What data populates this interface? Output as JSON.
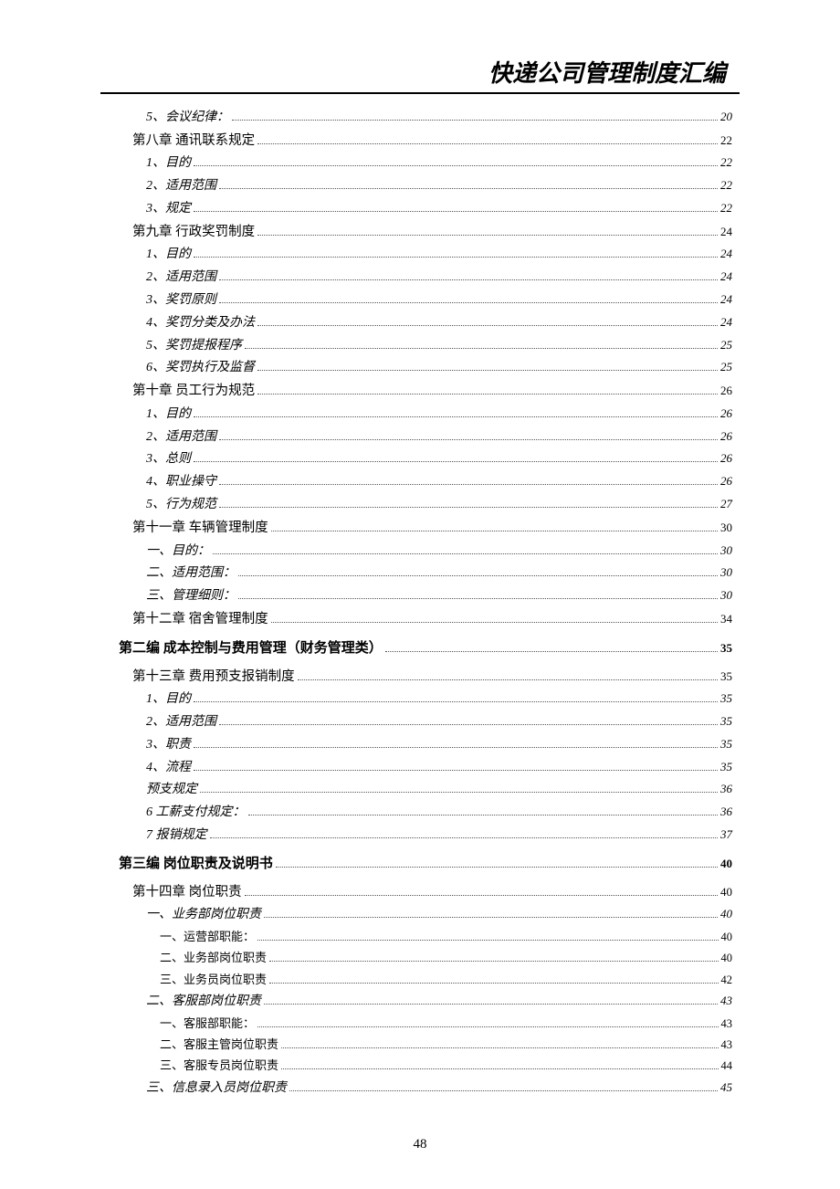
{
  "header": {
    "title": "快递公司管理制度汇编"
  },
  "toc": [
    {
      "indent": 2,
      "label": "5、会议纪律：",
      "page": "20"
    },
    {
      "indent": 1,
      "label": "第八章 通讯联系规定",
      "page": "22"
    },
    {
      "indent": 2,
      "label": "1、目的",
      "page": "22"
    },
    {
      "indent": 2,
      "label": "2、适用范围",
      "page": "22"
    },
    {
      "indent": 2,
      "label": "3、规定",
      "page": "22"
    },
    {
      "indent": 1,
      "label": "第九章 行政奖罚制度",
      "page": "24"
    },
    {
      "indent": 2,
      "label": "1、目的",
      "page": "24"
    },
    {
      "indent": 2,
      "label": "2、适用范围",
      "page": "24"
    },
    {
      "indent": 2,
      "label": "3、奖罚原则",
      "page": "24"
    },
    {
      "indent": 2,
      "label": "4、奖罚分类及办法",
      "page": "24"
    },
    {
      "indent": 2,
      "label": "5、奖罚提报程序",
      "page": "25"
    },
    {
      "indent": 2,
      "label": "6、奖罚执行及监督",
      "page": "25"
    },
    {
      "indent": 1,
      "label": "第十章 员工行为规范",
      "page": "26"
    },
    {
      "indent": 2,
      "label": "1、目的",
      "page": "26"
    },
    {
      "indent": 2,
      "label": "2、适用范围",
      "page": "26"
    },
    {
      "indent": 2,
      "label": "3、总则",
      "page": "26"
    },
    {
      "indent": 2,
      "label": "4、职业操守",
      "page": "26"
    },
    {
      "indent": 2,
      "label": "5、行为规范",
      "page": "27"
    },
    {
      "indent": 1,
      "label": "第十一章 车辆管理制度",
      "page": "30"
    },
    {
      "indent": 2,
      "label": "一、目的：",
      "page": "30"
    },
    {
      "indent": 2,
      "label": "二、适用范围：",
      "page": "30"
    },
    {
      "indent": 2,
      "label": "三、管理细则：",
      "page": "30"
    },
    {
      "indent": 1,
      "label": "第十二章 宿舍管理制度",
      "page": "34"
    },
    {
      "indent": 0,
      "label": "第二编  成本控制与费用管理（财务管理类）",
      "page": "35"
    },
    {
      "indent": 1,
      "label": "第十三章 费用预支报销制度",
      "page": "35"
    },
    {
      "indent": 2,
      "label": "1、目的",
      "page": "35"
    },
    {
      "indent": 2,
      "label": "2、适用范围",
      "page": "35"
    },
    {
      "indent": 2,
      "label": "3、职责",
      "page": "35"
    },
    {
      "indent": 2,
      "label": "4、流程",
      "page": "35"
    },
    {
      "indent": 2,
      "label": "预支规定",
      "page": "36"
    },
    {
      "indent": 2,
      "label": "6 工薪支付规定：",
      "page": "36"
    },
    {
      "indent": 2,
      "label": "7 报销规定",
      "page": "37"
    },
    {
      "indent": 0,
      "label": "第三编  岗位职责及说明书",
      "page": "40"
    },
    {
      "indent": 1,
      "label": "第十四章 岗位职责",
      "page": "40"
    },
    {
      "indent": 2,
      "label": "一、业务部岗位职责",
      "page": "40"
    },
    {
      "indent": 3,
      "label": "一、运营部职能：",
      "page": "40"
    },
    {
      "indent": 3,
      "label": "二、业务部岗位职责",
      "page": "40"
    },
    {
      "indent": 3,
      "label": "三、业务员岗位职责",
      "page": "42"
    },
    {
      "indent": 2,
      "label": "二、客服部岗位职责",
      "page": "43"
    },
    {
      "indent": 3,
      "label": "一、客服部职能：",
      "page": "43"
    },
    {
      "indent": 3,
      "label": "二、客服主管岗位职责",
      "page": "43"
    },
    {
      "indent": 3,
      "label": "三、客服专员岗位职责",
      "page": "44"
    },
    {
      "indent": 2,
      "label": "三、信息录入员岗位职责",
      "page": "45"
    }
  ],
  "pageNumber": "48"
}
